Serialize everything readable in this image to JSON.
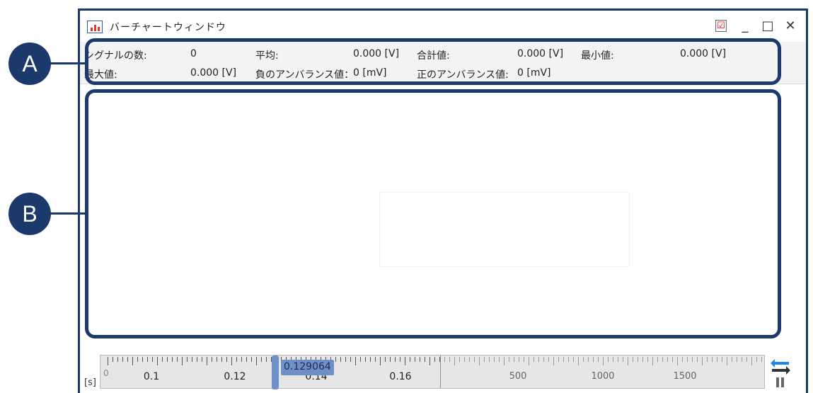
{
  "window": {
    "title": "バーチャートウィンドウ",
    "controls": {
      "minimize": "_",
      "maximize": "□",
      "close": "✕",
      "check": "☑"
    }
  },
  "info": {
    "signal_count_label": "シグナルの数:",
    "signal_count_value": "0",
    "average_label": "平均:",
    "average_value": "0.000 [V]",
    "sum_label": "合計値:",
    "sum_value": "0.000 [V]",
    "min_label": "最小値:",
    "min_value": "0.000 [V]",
    "max_label": "最大値:",
    "max_value": "0.000 [V]",
    "neg_unbalance_label": "負のアンバランス値：",
    "neg_unbalance_value": "0 [mV]",
    "pos_unbalance_label": "正のアンバランス値:",
    "pos_unbalance_value": "0 [mV]"
  },
  "timeline": {
    "unit": "[s]",
    "first_tick": "0",
    "left_labels": [
      "0.1",
      "0.12",
      "0.14",
      "0.16"
    ],
    "right_labels": [
      "500",
      "1000",
      "1500"
    ],
    "current_value": "0.129064"
  },
  "annotations": {
    "a": "A",
    "b": "B"
  },
  "colors": {
    "frame": "#1b3a6b",
    "accent": "#6f8fc9",
    "arrow_blue": "#1e88e5"
  }
}
